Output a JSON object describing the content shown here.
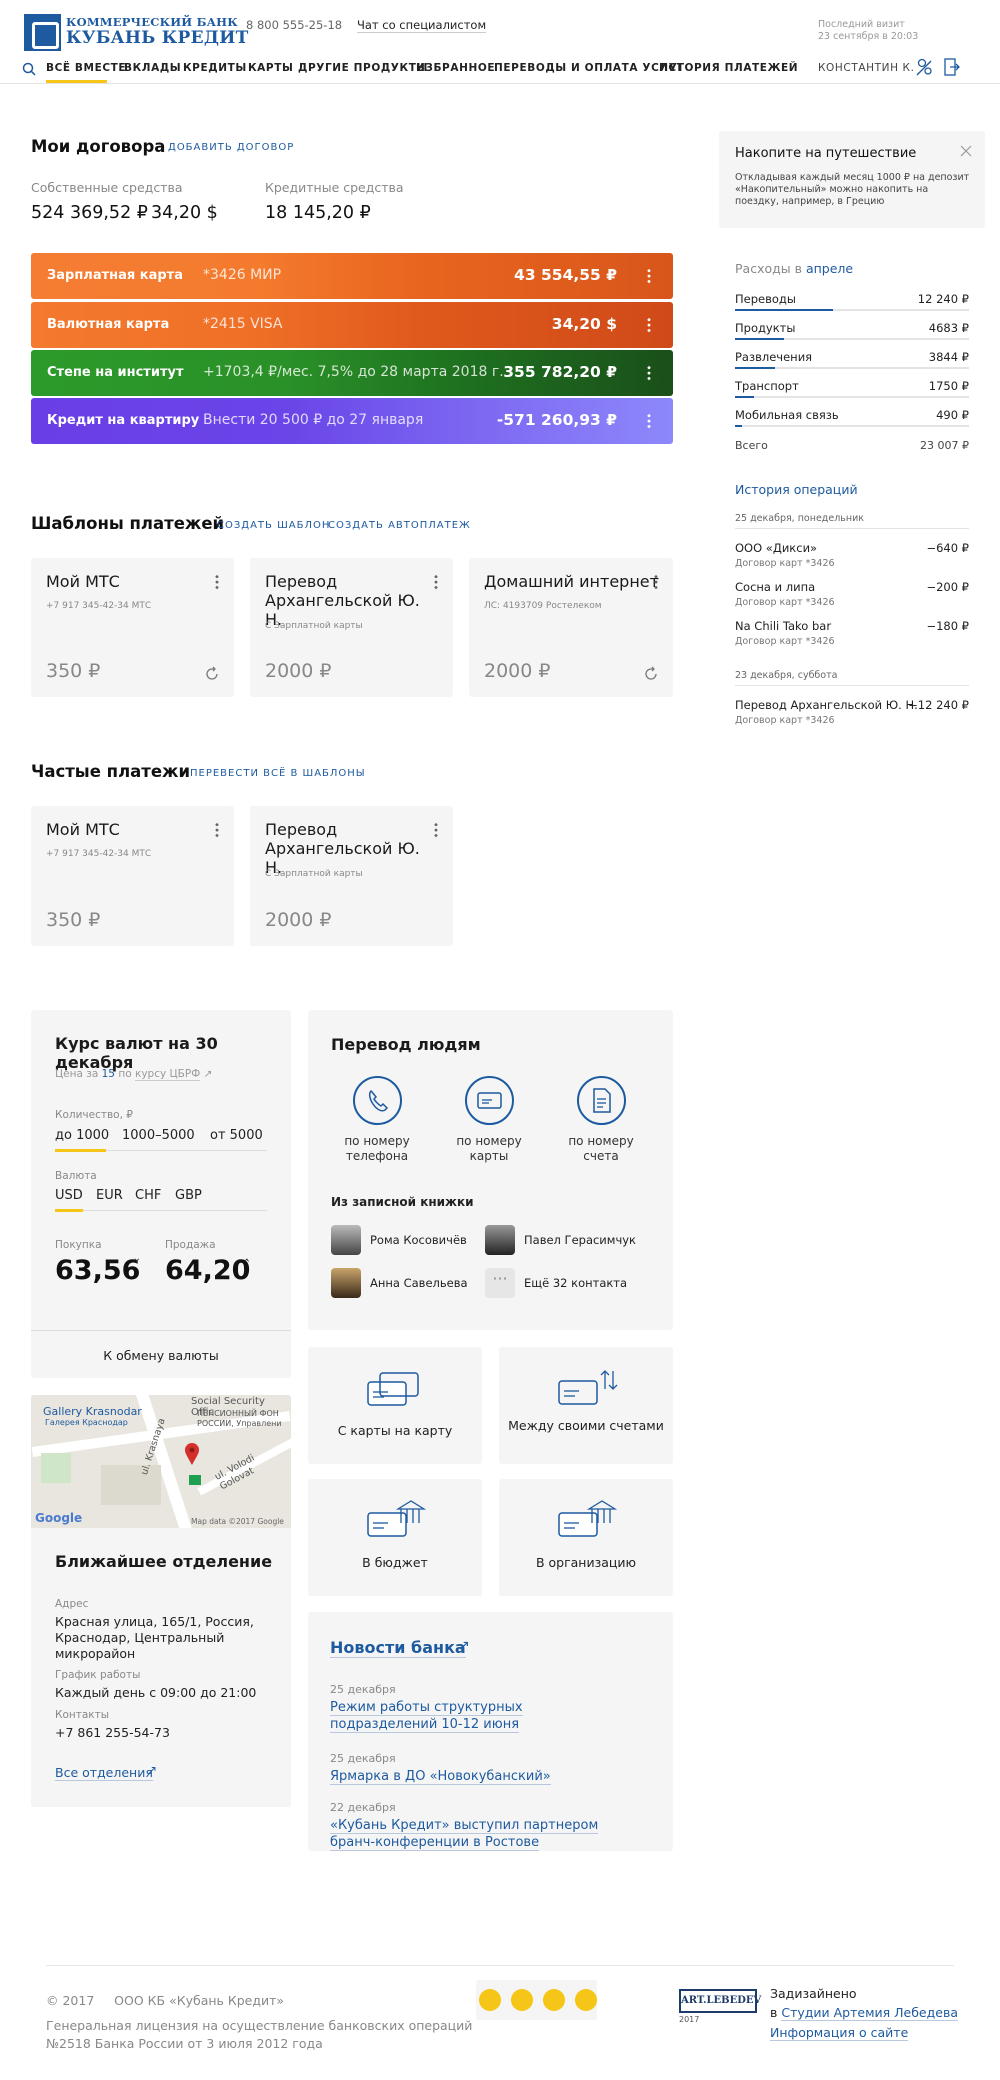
{
  "header": {
    "logo_line1": "КОММЕРЧЕСКИЙ БАНК",
    "logo_line2": "КУБАНЬ КРЕДИТ",
    "phone": "8 800 555-25-18",
    "chat": "Чат со специалистом",
    "last_visit_label": "Последний визит",
    "last_visit_value": "23 сентября в 20:03",
    "nav": [
      "ВСЁ ВМЕСТЕ",
      "ВКЛАДЫ",
      "КРЕДИТЫ",
      "КАРТЫ",
      "ДРУГИЕ ПРОДУКТЫ",
      "ИЗБРАННОЕ",
      "ПЕРЕВОДЫ И ОПЛАТА УСЛУГ",
      "ИСТОРИЯ ПЛАТЕЖЕЙ"
    ],
    "user": "КОНСТАНТИН К."
  },
  "contracts": {
    "title": "Мои договора",
    "add": "ДОБАВИТЬ ДОГОВОР",
    "own_label": "Собственные средства",
    "own_rub": "524 369,52 ₽",
    "own_usd": "34,20 $",
    "credit_label": "Кредитные средства",
    "credit_value": "18 145,20 ₽",
    "rows": [
      {
        "name": "Зарплатная карта",
        "mid": "*3426   МИР",
        "amount": "43 554,55 ₽"
      },
      {
        "name": "Валютная карта",
        "mid": "*2415   VISA",
        "amount": "34,20 $"
      },
      {
        "name": "Степе на институт",
        "mid": "+1703,4 ₽/мес.    7,5% до 28 марта 2018 г.",
        "amount": "355 782,20 ₽"
      },
      {
        "name": "Кредит на квартиру",
        "mid": "Внести 20 500 ₽ до 27 января",
        "amount": "-571 260,93 ₽"
      }
    ]
  },
  "templates": {
    "title": "Шаблоны платежей",
    "create": "СОЗДАТЬ ШАБЛОН",
    "auto": "СОЗДАТЬ АВТОПЛАТЕЖ",
    "items": [
      {
        "title": "Мой МТС",
        "sub": "+7 917 345-42-34   МТС",
        "price": "350 ₽"
      },
      {
        "title": "Перевод Архангельской Ю. Н.",
        "sub": "С Зарплатной карты",
        "price": "2000 ₽"
      },
      {
        "title": "Домашний интернет",
        "sub": "ЛС: 4193709   Ростелеком",
        "price": "2000 ₽"
      }
    ]
  },
  "frequent": {
    "title": "Частые платежи",
    "move": "ПЕРЕВЕСТИ ВСЁ В ШАБЛОНЫ",
    "items": [
      {
        "title": "Мой МТС",
        "sub": "+7 917 345-42-34   МТС",
        "price": "350 ₽"
      },
      {
        "title": "Перевод Архангельской Ю. Н.",
        "sub": "С Зарплатной карты",
        "price": "2000 ₽"
      }
    ]
  },
  "rates": {
    "title": "Курс валют на 30 декабря",
    "note_pre": "Цена за",
    "note_num": "15",
    "note_mid": "по",
    "note_link": "курсу ЦБРФ",
    "qty_label": "Количество, ₽",
    "qty": [
      "до 1000",
      "1000–5000",
      "от 5000"
    ],
    "cur_label": "Валюта",
    "cur": [
      "USD",
      "EUR",
      "CHF",
      "GBP"
    ],
    "buy_label": "Покупка",
    "buy": "63,56",
    "sell_label": "Продажа",
    "sell": "64,20",
    "exchange": "К обмену валюты"
  },
  "transfer": {
    "title": "Перевод людям",
    "ways": [
      "по номеру телефона",
      "по номеру карты",
      "по номеру счета"
    ],
    "book_title": "Из записной книжки",
    "contacts": [
      "Рома Косовичёв",
      "Павел Герасимчук",
      "Анна Савельева",
      "Ещё 32 контакта"
    ],
    "options": [
      "С карты на карту",
      "Между своими счетами",
      "В бюджет",
      "В организацию"
    ]
  },
  "map": {
    "labels": [
      "Gallery Krasnodar",
      "Галерея Краснодар",
      "Social Security Offic",
      "ПЕНСИОННЫЙ ФОН",
      "РОССИИ, Управлени",
      "ul. Krasnaya",
      "ul. Volodi Golovat",
      "Google",
      "Map data ©2017 Google"
    ]
  },
  "branch": {
    "title": "Ближайшее отделение",
    "addr_label": "Адрес",
    "addr": "Красная улица, 165/1, Россия, Краснодар, Центральный микрорайон",
    "hours_label": "График работы",
    "hours": "Каждый день с 09:00 до 21:00",
    "contacts_label": "Контакты",
    "phone": "+7 861 255-54-73",
    "all": "Все отделения"
  },
  "news": {
    "title": "Новости банка",
    "items": [
      {
        "date": "25 декабря",
        "text": "Режим работы структурных подразделений 10-12 июня"
      },
      {
        "date": "25 декабря",
        "text": "Ярмарка в ДО «Новокубанский»"
      },
      {
        "date": "22 декабря",
        "text": "«Кубань Кредит» выступил партнером бранч-конференции в Ростове"
      }
    ]
  },
  "promo": {
    "title": "Накопите на путешествие",
    "text": "Откладывая каждый месяц 1000 ₽ на депозит «Накопительный» можно накопить на поездку, например, в Грецию"
  },
  "expenses": {
    "title_pre": "Расходы в",
    "month": "апреле",
    "rows": [
      {
        "name": "Переводы",
        "value": "12 240 ₽",
        "share": 0.42
      },
      {
        "name": "Продукты",
        "value": "4683 ₽",
        "share": 0.21
      },
      {
        "name": "Развлечения",
        "value": "3844 ₽",
        "share": 0.17
      },
      {
        "name": "Транспорт",
        "value": "1750 ₽",
        "share": 0.08
      },
      {
        "name": "Мобильная связь",
        "value": "490 ₽",
        "share": 0.03
      }
    ],
    "total_label": "Всего",
    "total": "23 007 ₽"
  },
  "history": {
    "title": "История операций",
    "day1": "25 декабря, понедельник",
    "day2": "23 декабря, суббота",
    "ops": [
      {
        "name": "ООО «Дикси»",
        "card": "Договор карт *3426",
        "value": "−640 ₽"
      },
      {
        "name": "Сосна и липа",
        "card": "Договор карт *3426",
        "value": "−200 ₽"
      },
      {
        "name": "Na Chili Tako bar",
        "card": "Договор карт *3426",
        "value": "−180 ₽"
      },
      {
        "name": "Перевод Архангельской Ю. Н.",
        "card": "Договор карт *3426",
        "value": "−12 240 ₽"
      }
    ]
  },
  "footer": {
    "copy": "© 2017     ООО КБ «Кубань Кредит»",
    "license1": "Генеральная лицензия на осуществление банковских операций",
    "license2": "№2518 Банка России от 3 июля 2012 года",
    "lebedev_logo": "ART.LEBEDEV",
    "lebedev_year": "2017",
    "designed": "Задизайнено",
    "in": "в",
    "studio": "Студии Артемия Лебедева",
    "about": "Информация о сайте"
  },
  "colors": {
    "brand": "#1d5a9f",
    "social": "#f5c518",
    "nav_underline": "#f5c518"
  }
}
